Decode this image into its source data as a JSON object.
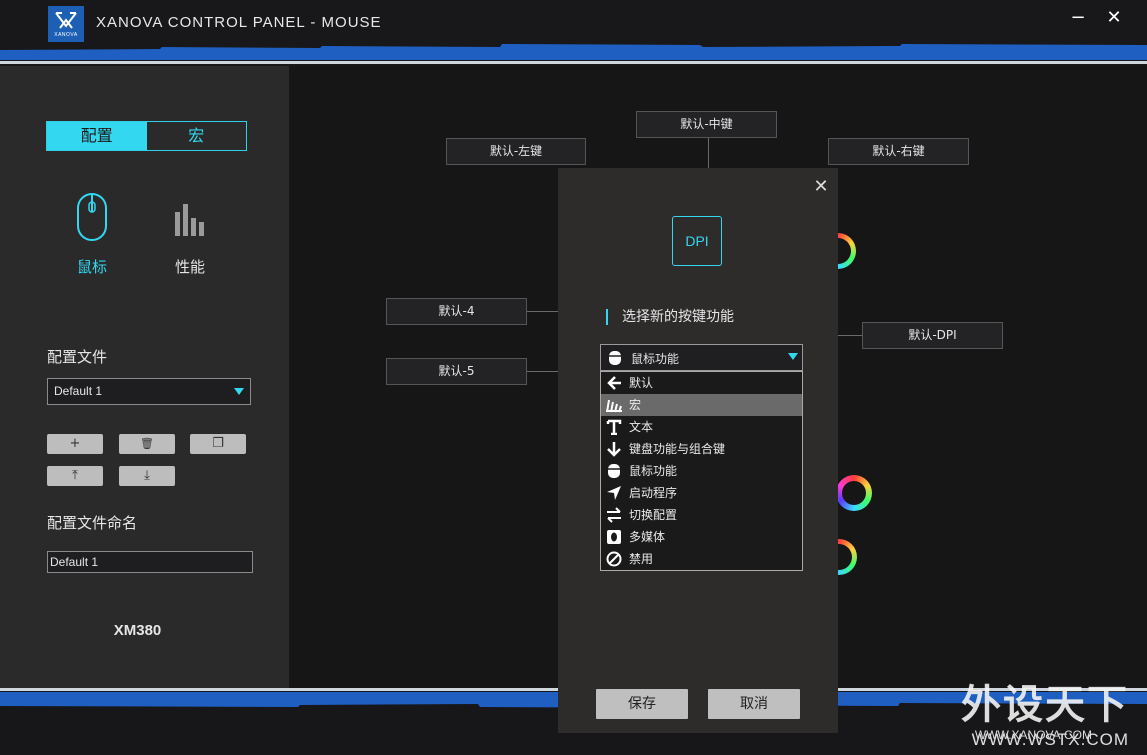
{
  "app": {
    "title": "XANOVA CONTROL PANEL - MOUSE",
    "logo_text": "XANOVA"
  },
  "window_controls": {
    "minimize": "−",
    "close": "✕"
  },
  "sidebar": {
    "tabs": [
      {
        "label": "配置",
        "active": true
      },
      {
        "label": "宏",
        "active": false
      }
    ],
    "modes": [
      {
        "label": "鼠标",
        "icon": "mouse-icon",
        "active": true
      },
      {
        "label": "性能",
        "icon": "performance-icon",
        "active": false
      }
    ],
    "profile_label": "配置文件",
    "profile_selected": "Default 1",
    "profile_actions": [
      {
        "icon": "add-icon",
        "glyph": "+"
      },
      {
        "icon": "trash-icon",
        "glyph": "🗑"
      },
      {
        "icon": "copy-icon",
        "glyph": "❐"
      },
      {
        "icon": "upload-icon",
        "glyph": "⤒"
      },
      {
        "icon": "download-icon",
        "glyph": "⤓"
      }
    ],
    "rename_label": "配置文件命名",
    "rename_value": "Default 1",
    "model": "XM380"
  },
  "buttons_map": {
    "left": "默认-左键",
    "middle": "默认-中键",
    "right": "默认-右键",
    "btn4": "默认-4",
    "btn5": "默认-5",
    "dpi": "默认-DPI"
  },
  "modal": {
    "icon_text": "DPI",
    "label": "选择新的按键功能",
    "selected": "鼠标功能",
    "options": [
      {
        "label": "默认",
        "icon": "arrow-left-icon",
        "highlighted": false
      },
      {
        "label": "宏",
        "icon": "macro-icon",
        "highlighted": true
      },
      {
        "label": "文本",
        "icon": "text-icon",
        "highlighted": false
      },
      {
        "label": "键盘功能与组合键",
        "icon": "arrow-down-icon",
        "highlighted": false
      },
      {
        "label": "鼠标功能",
        "icon": "mouse-function-icon",
        "highlighted": false
      },
      {
        "label": "启动程序",
        "icon": "launch-icon",
        "highlighted": false
      },
      {
        "label": "切换配置",
        "icon": "switch-icon",
        "highlighted": false
      },
      {
        "label": "多媒体",
        "icon": "media-icon",
        "highlighted": false
      },
      {
        "label": "禁用",
        "icon": "disable-icon",
        "highlighted": false
      }
    ],
    "save": "保存",
    "cancel": "取消",
    "close": "✕"
  },
  "watermark": {
    "big": "外设天下",
    "small": "WWW.WSTX.COM",
    "site": "WWW.XANOVA.COM"
  },
  "colors": {
    "accent": "#33d8f0",
    "stripe_blue": "#1f5fc2"
  }
}
